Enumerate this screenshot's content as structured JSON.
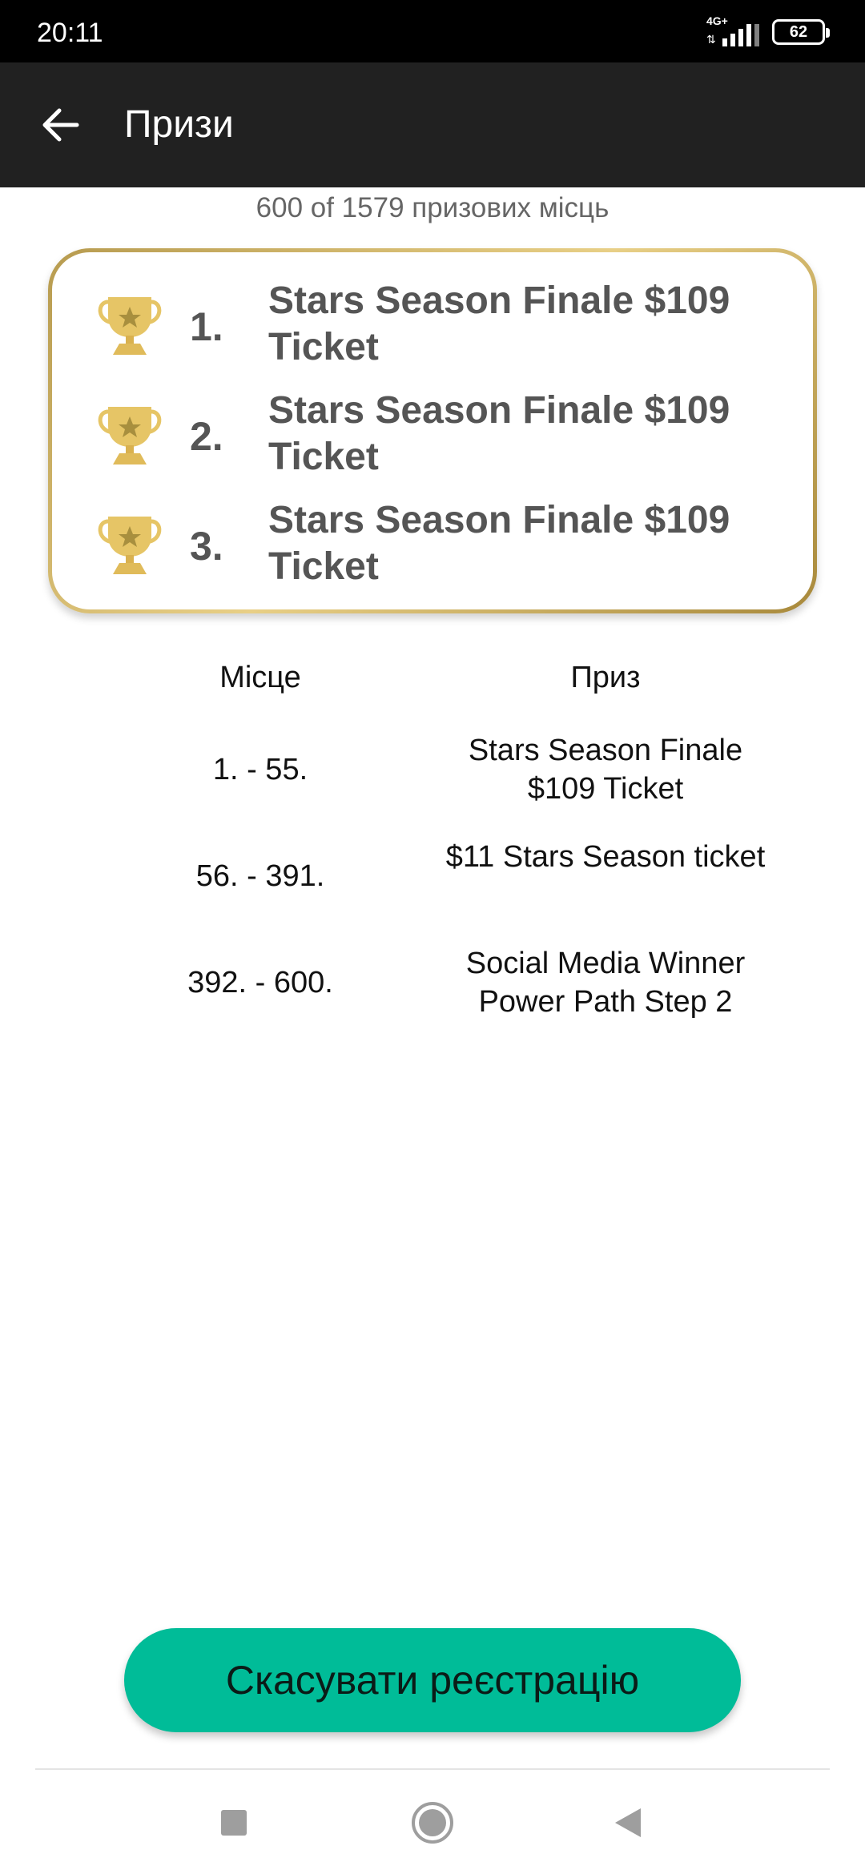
{
  "status_bar": {
    "time": "20:11",
    "network": "4G+",
    "battery": "62"
  },
  "app_bar": {
    "title": "Призи"
  },
  "summary": {
    "places_text": "600 of 1579  призових місць"
  },
  "top_prizes": [
    {
      "rank": "1.",
      "prize": "Stars Season Finale $109 Ticket"
    },
    {
      "rank": "2.",
      "prize": "Stars Season Finale $109 Ticket"
    },
    {
      "rank": "3.",
      "prize": "Stars Season Finale $109 Ticket"
    }
  ],
  "table": {
    "headers": {
      "place": "Місце",
      "prize": "Приз"
    },
    "rows": [
      {
        "place": "1. - 55.",
        "prize": "Stars Season Finale $109 Ticket"
      },
      {
        "place": "56. - 391.",
        "prize": "$11 Stars Season ticket"
      },
      {
        "place": "392. - 600.",
        "prize": "Social Media Winner Power Path Step 2"
      }
    ]
  },
  "actions": {
    "cancel_label": "Скасувати реєстрацію"
  },
  "colors": {
    "accent": "#00bc98",
    "app_bar": "#212121",
    "gold": "#d4b565"
  },
  "icons": {
    "back": "arrow-left-icon",
    "trophy": "trophy-icon",
    "recent": "square-icon",
    "home": "circle-icon",
    "nav_back": "triangle-back-icon"
  }
}
